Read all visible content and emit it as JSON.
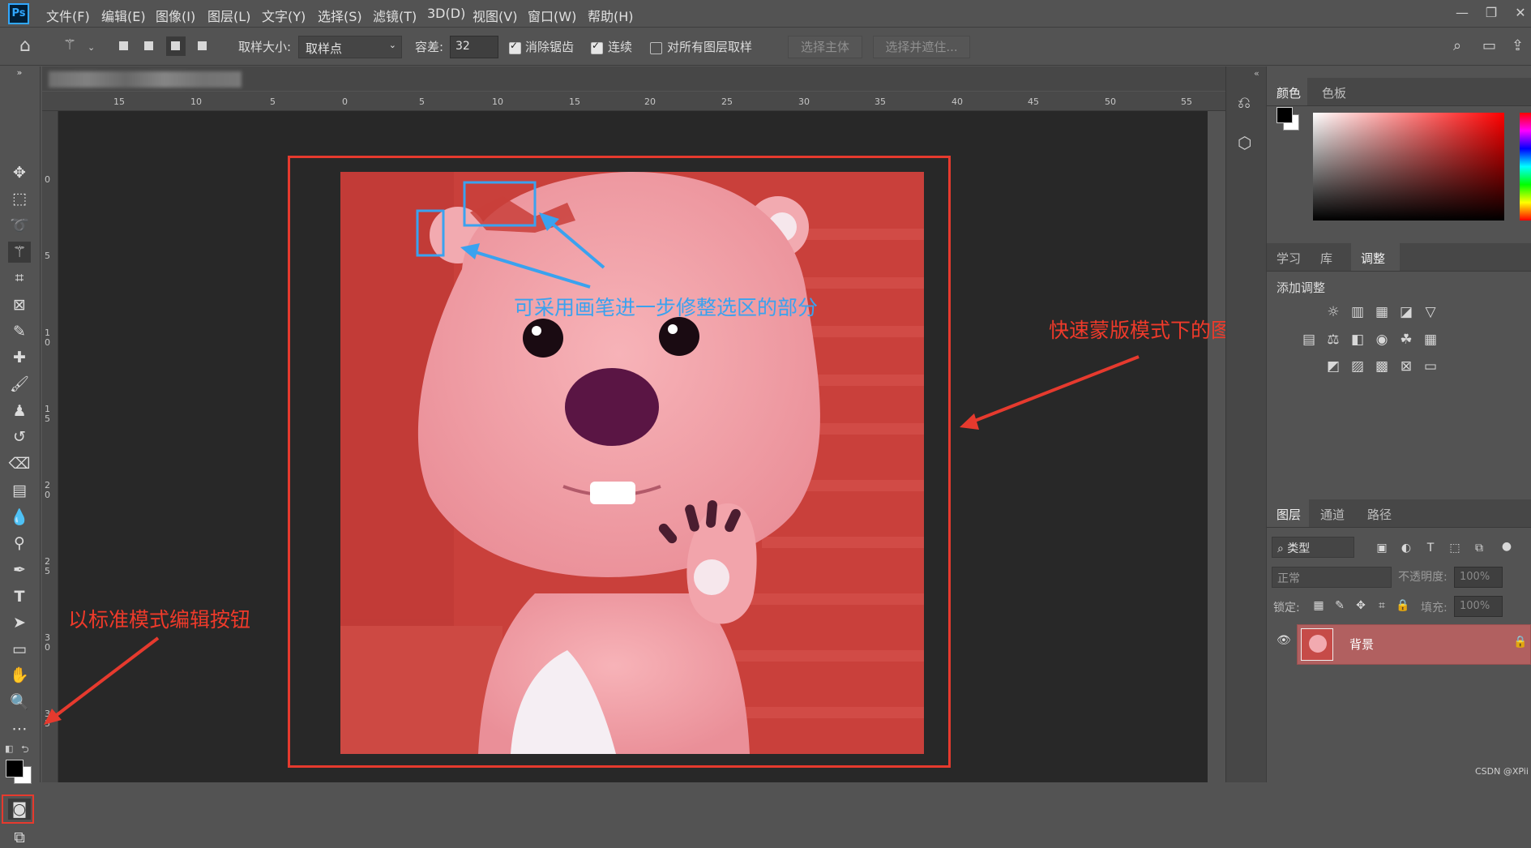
{
  "app": {
    "logo": "Ps"
  },
  "menu": [
    "文件(F)",
    "编辑(E)",
    "图像(I)",
    "图层(L)",
    "文字(Y)",
    "选择(S)",
    "滤镜(T)",
    "3D(D)",
    "视图(V)",
    "窗口(W)",
    "帮助(H)"
  ],
  "window_controls": {
    "minimize": "—",
    "restore": "❐",
    "close": "✕"
  },
  "options": {
    "sample_size_label": "取样大小:",
    "sample_size_value": "取样点",
    "tolerance_label": "容差:",
    "tolerance_value": "32",
    "antialias_label": "消除锯齿",
    "antialias_checked": true,
    "contiguous_label": "连续",
    "contiguous_checked": true,
    "sample_all_label": "对所有图层取样",
    "sample_all_checked": false,
    "select_subject": "选择主体",
    "select_and_mask": "选择并遮住..."
  },
  "rulers": {
    "horizontal": [
      "15",
      "10",
      "5",
      "0",
      "5",
      "10",
      "15",
      "20",
      "25",
      "30",
      "35",
      "40",
      "45",
      "50",
      "55"
    ],
    "vertical": [
      "0",
      "5",
      "1\n0",
      "1\n5",
      "2\n0",
      "2\n5",
      "3\n0",
      "3\n5"
    ]
  },
  "panels": {
    "color_tabs": [
      "颜色",
      "色板"
    ],
    "adjust_tabs": [
      "学习",
      "库",
      "调整"
    ],
    "add_adjustment": "添加调整",
    "layers_tabs": [
      "图层",
      "通道",
      "路径"
    ],
    "filter_kind": "类型",
    "blend_mode": "正常",
    "opacity_label": "不透明度:",
    "opacity_value": "100%",
    "lock_label": "锁定:",
    "fill_label": "填充:",
    "fill_value": "100%",
    "layer_name": "背景"
  },
  "annotations": {
    "refine_note": "可采用画笔进一步修整选区的部分",
    "quickmask_note": "快速蒙版模式下的图像",
    "standard_mode_note": "以标准模式编辑按钮"
  },
  "watermark": "CSDN @XPii",
  "colors": {
    "annotation_red": "#e63a2e",
    "annotation_blue": "#3aa2ef",
    "quickmask_overlay": "#d9453f"
  }
}
